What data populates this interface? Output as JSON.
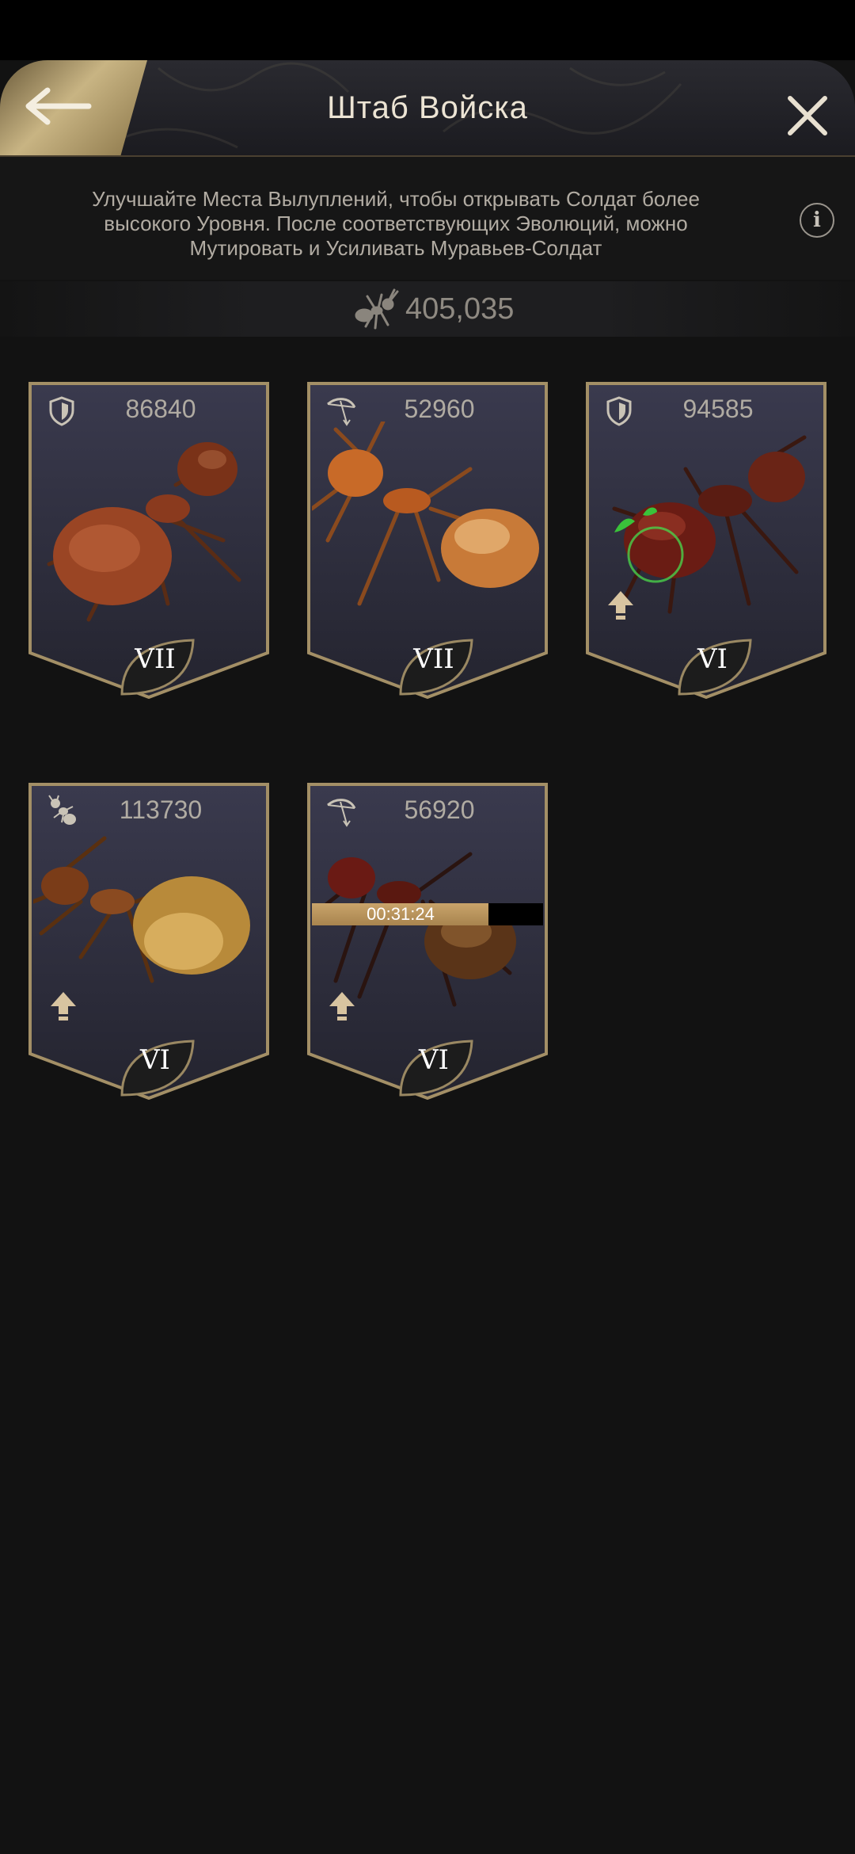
{
  "header": {
    "title": "Штаб Войска",
    "back_icon": "arrow-left-icon",
    "close_icon": "close-icon"
  },
  "info": {
    "text": "Улучшайте Места Вылуплений, чтобы открывать Солдат более высокого Уровня. После соответствующих Эволюций, можно Мутировать и Усиливать Муравьев-Солдат",
    "icon": "info-icon",
    "icon_glyph": "i"
  },
  "troops": {
    "icon": "ant-icon",
    "total": "405,035"
  },
  "colors": {
    "background": "#121212",
    "gold_accent": "#c8b483",
    "timer_fill": "#c9a46b"
  },
  "cards": [
    {
      "power": "86840",
      "class_icon": "shield-icon",
      "rank": "VII",
      "upgrade": false,
      "ant": "fire-ant"
    },
    {
      "power": "52960",
      "class_icon": "bow-icon",
      "rank": "VII",
      "upgrade": false,
      "ant": "honeypot-ant"
    },
    {
      "power": "94585",
      "class_icon": "shield-icon",
      "rank": "VI",
      "upgrade": true,
      "ant": "red-ant-mutated"
    },
    {
      "power": "113730",
      "class_icon": "ant-small-icon",
      "rank": "VI",
      "upgrade": true,
      "ant": "amber-ant"
    },
    {
      "power": "56920",
      "class_icon": "bow-icon",
      "rank": "VI",
      "upgrade": true,
      "ant": "dark-ant",
      "timer": {
        "text": "00:31:24",
        "progress": 0.765
      }
    }
  ]
}
